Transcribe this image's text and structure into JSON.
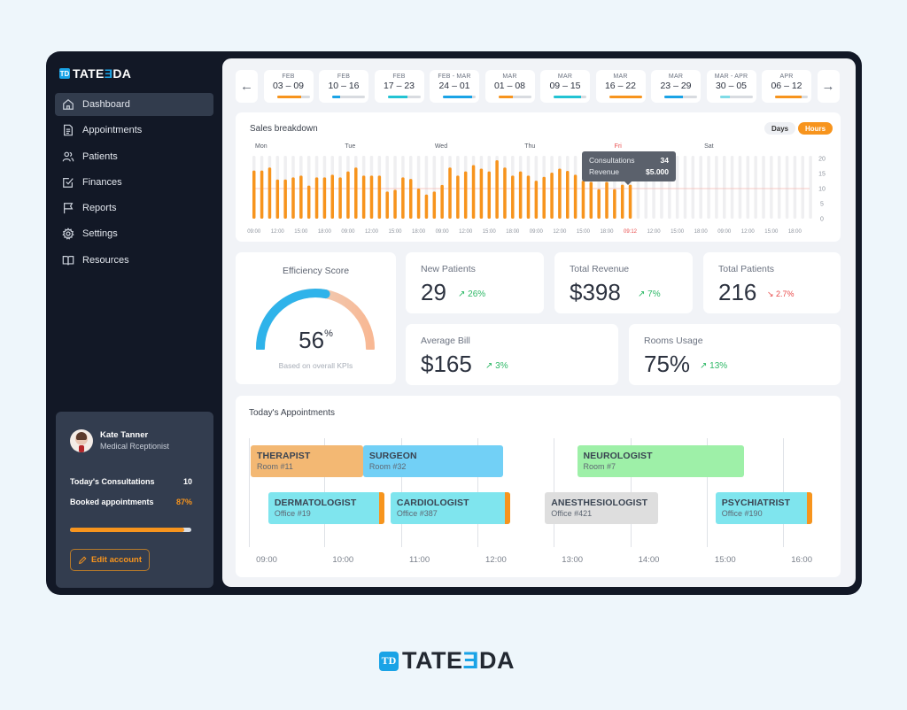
{
  "brand": {
    "name_prefix": "TATE",
    "name_mid": "Ǝ",
    "name_suffix": "DA",
    "mark": "TD",
    "accent": "#1aa3e6"
  },
  "sidebar": {
    "items": [
      {
        "label": "Dashboard",
        "icon": "home-icon",
        "active": true
      },
      {
        "label": "Appointments",
        "icon": "document-icon",
        "active": false
      },
      {
        "label": "Patients",
        "icon": "users-icon",
        "active": false
      },
      {
        "label": "Finances",
        "icon": "checkbox-icon",
        "active": false
      },
      {
        "label": "Reports",
        "icon": "flag-icon",
        "active": false
      },
      {
        "label": "Settings",
        "icon": "gear-icon",
        "active": false
      },
      {
        "label": "Resources",
        "icon": "book-icon",
        "active": false
      }
    ],
    "user": {
      "name": "Kate Tanner",
      "role": "Medical Rceptionist",
      "consultations_label": "Today's Consultations",
      "consultations_value": "10",
      "booked_label": "Booked appointments",
      "booked_value": "87%",
      "booked_fraction": 0.94,
      "edit_label": "Edit account"
    }
  },
  "weeks": {
    "prev_icon": "arrow-left-icon",
    "next_icon": "arrow-right-icon",
    "items": [
      {
        "month": "FEB",
        "days": "03 – 09",
        "progress": 0.75,
        "color": "#f7941d"
      },
      {
        "month": "FEB",
        "days": "10 – 16",
        "progress": 0.25,
        "color": "#1aa3e6"
      },
      {
        "month": "FEB",
        "days": "17 – 23",
        "progress": 0.6,
        "color": "#22c3d3"
      },
      {
        "month": "FEB - MAR",
        "days": "24 – 01",
        "progress": 0.88,
        "color": "#1aa3e6"
      },
      {
        "month": "MAR",
        "days": "01 – 08",
        "progress": 0.45,
        "color": "#f7941d"
      },
      {
        "month": "MAR",
        "days": "09 – 15",
        "progress": 0.85,
        "color": "#22c3d3"
      },
      {
        "month": "MAR",
        "days": "16 – 22",
        "progress": 1.0,
        "color": "#f7941d"
      },
      {
        "month": "MAR",
        "days": "23 – 29",
        "progress": 0.58,
        "color": "#1aa3e6"
      },
      {
        "month": "MAR - APR",
        "days": "30 – 05",
        "progress": 0.3,
        "color": "#7fdbe6"
      },
      {
        "month": "APR",
        "days": "06 – 12",
        "progress": 0.82,
        "color": "#f7941d"
      }
    ]
  },
  "sales": {
    "title": "Sales breakdown",
    "toggle_days": "Days",
    "toggle_hours": "Hours",
    "tooltip": {
      "consultations_label": "Consultations",
      "consultations_value": "34",
      "revenue_label": "Revenue",
      "revenue_value": "$5.000"
    }
  },
  "chart_data": {
    "type": "bar",
    "title": "Sales breakdown",
    "days": [
      "Mon",
      "Tue",
      "Wed",
      "Thu",
      "Fri",
      "Sat"
    ],
    "highlight_day": "Fri",
    "x_tick_labels": [
      "09:00",
      "12:00",
      "15:00",
      "18:00",
      "09:00",
      "12:00",
      "15:00",
      "18:00",
      "09:00",
      "12:00",
      "15:00",
      "18:00",
      "09:00",
      "12:00",
      "15:00",
      "18:00",
      "09:12",
      "12:00",
      "15:00",
      "18:00",
      "09:00",
      "12:00",
      "15:00",
      "18:00"
    ],
    "highlight_tick": "09:12",
    "y_ticks": [
      0,
      5,
      10,
      15,
      20
    ],
    "ylim": [
      0,
      20
    ],
    "reference_line": 10,
    "total_slots": 72,
    "values": [
      16,
      16,
      17,
      13,
      13,
      13.7,
      14.3,
      11,
      13.7,
      13.7,
      14.6,
      13.7,
      15.7,
      17,
      14.3,
      14.3,
      14.3,
      9,
      9.6,
      13.7,
      13.2,
      10,
      8,
      9,
      11.2,
      17,
      14.3,
      15.7,
      17.8,
      16.6,
      15.7,
      19.4,
      17,
      14.3,
      15.7,
      14.3,
      12.6,
      13.9,
      15.3,
      16.6,
      15.9,
      14.6,
      12.6,
      12.2,
      9.8,
      12.2,
      9.8,
      11.3,
      11.3
    ],
    "bar_color": "#f7941d",
    "empty_color": "#efeff1"
  },
  "efficiency": {
    "title": "Efficiency Score",
    "value": "56",
    "unit": "%",
    "fraction": 0.56,
    "subtitle": "Based on overall KPIs"
  },
  "kpis": [
    {
      "label": "New Patients",
      "value": "29",
      "change": "↗ 26%",
      "trend": "up"
    },
    {
      "label": "Total Revenue",
      "value": "$398",
      "change": "↗ 7%",
      "trend": "up"
    },
    {
      "label": "Total Patients",
      "value": "216",
      "change": "↘ 2.7%",
      "trend": "down"
    },
    {
      "label": "Average Bill",
      "value": "$165",
      "change": "↗ 3%",
      "trend": "up"
    },
    {
      "label": "Rooms Usage",
      "value": "75%",
      "change": "↗ 13%",
      "trend": "up"
    }
  ],
  "appointments": {
    "title": "Today's Appointments",
    "times": [
      "09:00",
      "10:00",
      "11:00",
      "12:00",
      "13:00",
      "14:00",
      "15:00",
      "16:00"
    ],
    "items": [
      {
        "title": "THERAPIST",
        "room": "Room #11",
        "start": 9.0,
        "end": 10.47,
        "row": 0,
        "color": "#f3b873",
        "accent": false
      },
      {
        "title": "SURGEON",
        "room": "Room #32",
        "start": 10.47,
        "end": 12.3,
        "row": 0,
        "color": "#72d0f6",
        "accent": false
      },
      {
        "title": "NEUROLOGIST",
        "room": "Room #7",
        "start": 13.27,
        "end": 15.45,
        "row": 0,
        "color": "#9ef0a8",
        "accent": false
      },
      {
        "title": "DERMATOLOGIST",
        "room": "Office #19",
        "start": 9.23,
        "end": 10.75,
        "row": 1,
        "color": "#7fe5ee",
        "accent": true
      },
      {
        "title": "CARDIOLOGIST",
        "room": "Office #387",
        "start": 10.83,
        "end": 12.4,
        "row": 1,
        "color": "#7fe5ee",
        "accent": true
      },
      {
        "title": "ANESTHESIOLOGIST",
        "room": "Office #421",
        "start": 12.85,
        "end": 14.33,
        "row": 1,
        "color": "#dedede",
        "accent": false
      },
      {
        "title": "PSYCHIATRIST",
        "room": "Office #190",
        "start": 15.08,
        "end": 16.35,
        "row": 1,
        "color": "#7fe5ee",
        "accent": true
      }
    ]
  }
}
